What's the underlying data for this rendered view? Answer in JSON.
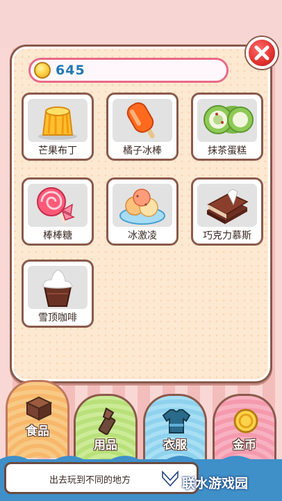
{
  "wallet": {
    "coins": "645"
  },
  "items": [
    {
      "label": "芒果布丁",
      "icon": "mango-pudding-icon"
    },
    {
      "label": "橘子冰棒",
      "icon": "orange-popsicle-icon"
    },
    {
      "label": "抹茶蛋糕",
      "icon": "matcha-roll-cake-icon"
    },
    {
      "label": "棒棒糖",
      "icon": "lollipop-icon"
    },
    {
      "label": "冰激凌",
      "icon": "ice-cream-icon"
    },
    {
      "label": "巧克力慕斯",
      "icon": "chocolate-mousse-icon"
    },
    {
      "label": "雪顶咖啡",
      "icon": "snow-top-coffee-icon"
    }
  ],
  "tabs": [
    {
      "label": "食品",
      "icon": "food-box-icon",
      "active": true
    },
    {
      "label": "用品",
      "icon": "lipstick-icon",
      "active": false
    },
    {
      "label": "衣服",
      "icon": "shirt-icon",
      "active": false
    },
    {
      "label": "金币",
      "icon": "coin-icon",
      "active": false
    }
  ],
  "footer": {
    "message": "出去玩到不同的地方",
    "brand": "联水游戏园"
  }
}
